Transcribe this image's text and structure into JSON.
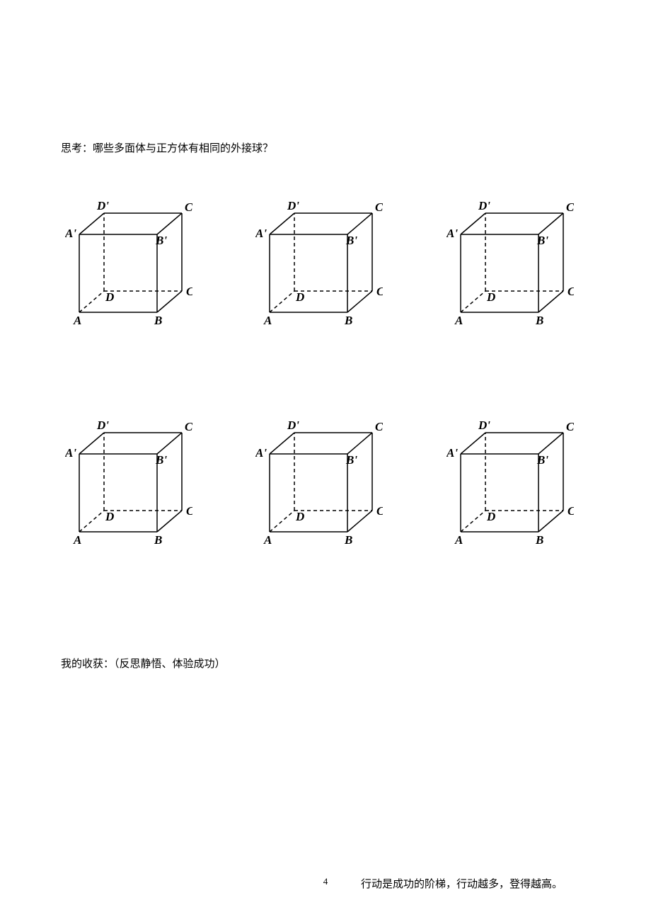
{
  "question": "思考：哪些多面体与正方体有相同的外接球？",
  "harvest": "我的收获：（反思静悟、体验成功）",
  "page_number": "4",
  "footer_note": "行动是成功的阶梯，行动越多，登得越高。",
  "cube_labels": {
    "A": "A",
    "B": "B",
    "C": "C",
    "D": "D",
    "Ap": "A'",
    "Bp": "B'",
    "Cp": "C'",
    "Dp": "D'"
  }
}
